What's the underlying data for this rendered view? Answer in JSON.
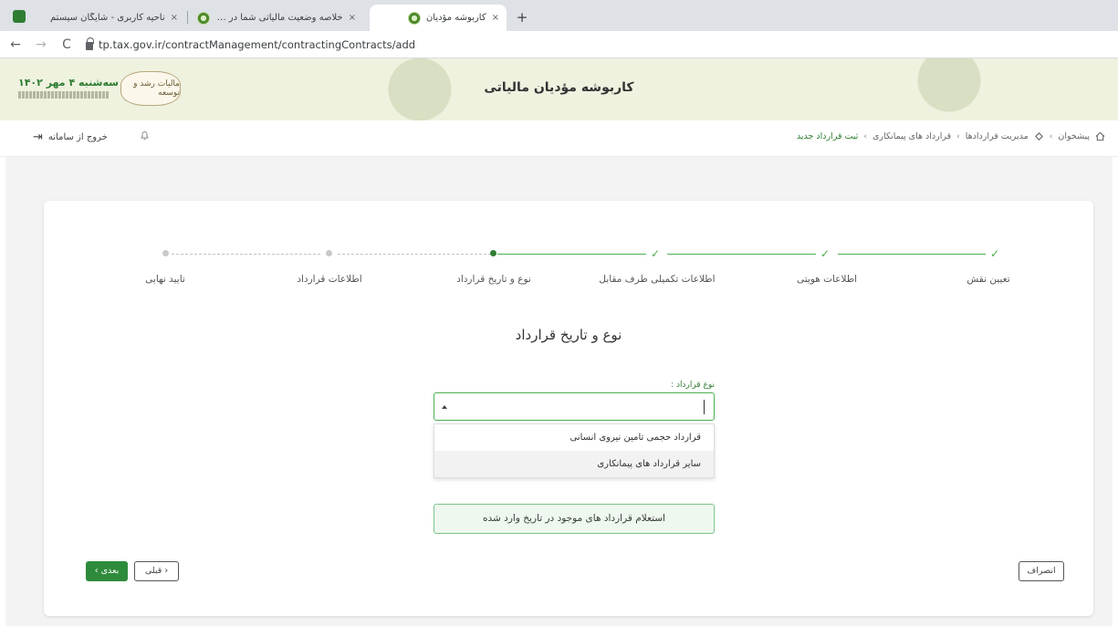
{
  "browser": {
    "tabs": [
      {
        "title": "ناحیه کاربری - شایگان سیستم",
        "active": false
      },
      {
        "title": "خلاصه وضعیت مالیاتی شما در نظ",
        "active": false
      },
      {
        "title": "کاربوشه مؤدیان",
        "active": true
      }
    ],
    "close_glyph": "×",
    "new_tab_glyph": "+",
    "url": "tp.tax.gov.ir/contractManagement/contractingContracts/add",
    "back_glyph": "←",
    "forward_glyph": "→",
    "reload_glyph": "C"
  },
  "header": {
    "title": "کاربوشه مؤدیان مالیاتی",
    "date": "سه‌شنبه ۴ مهر ۱۴۰۲",
    "logo_text": "ماليات رشد و توسعه"
  },
  "breadcrumb": {
    "items": [
      "پیشخوان",
      "مدیریت قراردادها",
      "قرارداد های پیمانکاری",
      "ثبت قرارداد جدید"
    ],
    "separator": "›"
  },
  "userbar": {
    "logout_label": "خروج از سامانه",
    "logout_glyph": "⇥",
    "bell_glyph": "🔔"
  },
  "stepper": {
    "steps": [
      {
        "label": "تعیین نقش",
        "state": "done"
      },
      {
        "label": "اطلاعات هویتی",
        "state": "done"
      },
      {
        "label": "اطلاعات تکمیلی طرف مقابل",
        "state": "done"
      },
      {
        "label": "نوع و تاریخ قرارداد",
        "state": "current"
      },
      {
        "label": "اطلاعات قرارداد",
        "state": "pending"
      },
      {
        "label": "تایید نهایی",
        "state": "pending"
      }
    ],
    "check_glyph": "✓"
  },
  "form": {
    "section_title": "نوع و تاریخ قرارداد",
    "contract_type_label": "نوع قرارداد :",
    "contract_type_value": "",
    "options": [
      "قرارداد حجمی تامین نیروی انسانی",
      "سایر قرارداد های پیمانکاری"
    ],
    "inquiry_button": "استعلام قرارداد های موجود در تاریخ وارد شده"
  },
  "actions": {
    "next_label": "بعدی ›",
    "prev_label": "‹ قبلی",
    "cancel_label": "انصراف"
  },
  "colors": {
    "accent": "#2e7d32",
    "step_done": "#4caf50",
    "header_bg": "#eef2df"
  }
}
